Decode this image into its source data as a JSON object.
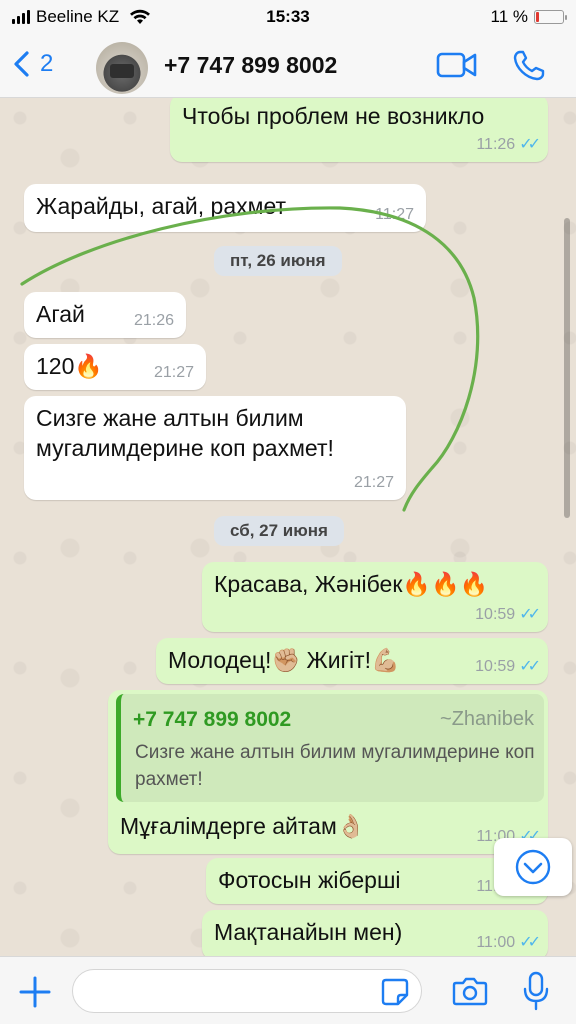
{
  "status_bar": {
    "carrier": "Beeline KZ",
    "time": "15:33",
    "battery": "11 %",
    "battery_level": 0.11
  },
  "header": {
    "back_count": "2",
    "contact": "+7 747 899 8002",
    "icons": [
      "chevron-left-icon",
      "video-call-icon",
      "phone-call-icon"
    ]
  },
  "messages": [
    {
      "dir": "out",
      "text": "Чтобы проблем не возникло",
      "time": "11:26",
      "read": true
    },
    {
      "dir": "in",
      "text": "Жарайды, агай, рахмет",
      "time": "11:27"
    },
    {
      "dir": "date",
      "text": "пт, 26 июня"
    },
    {
      "dir": "in",
      "text": "Агай",
      "time": "21:26"
    },
    {
      "dir": "in",
      "text": "120🔥",
      "time": "21:27"
    },
    {
      "dir": "in",
      "text": "Сизге жане алтын билим мугалимдерине коп рахмет!",
      "time": "21:27"
    },
    {
      "dir": "date",
      "text": "сб, 27 июня"
    },
    {
      "dir": "out",
      "text": "Красава, Жәнібек🔥🔥🔥",
      "time": "10:59",
      "read": true
    },
    {
      "dir": "out",
      "text": "Молодец!✊🏼 Жигіт!💪🏼",
      "time": "10:59",
      "read": true
    },
    {
      "dir": "out",
      "text": "Мұғалімдерге айтам👌🏼",
      "time": "11:00",
      "read": true,
      "quote": {
        "number": "+7 747 899 8002",
        "author": "~Zhanibek",
        "text": "Сизге жане алтын билим мугалимдерине коп рахмет!"
      }
    },
    {
      "dir": "out",
      "text": "Фотосын жіберші",
      "time": "11:00",
      "read": true
    },
    {
      "dir": "out",
      "text": "Мақтанайын мен)",
      "time": "11:00",
      "read": true
    }
  ],
  "input": {
    "placeholder": "",
    "icons": [
      "plus-icon",
      "sticker-icon",
      "camera-icon",
      "microphone-icon"
    ]
  },
  "colors": {
    "accent": "#1d7df2",
    "outgoing_bubble": "#dcf8c6",
    "incoming_bubble": "#ffffff",
    "read_ticks": "#4fb6ec",
    "quote_accent": "#3daa2a",
    "annotation_stroke": "#6ab04c"
  }
}
